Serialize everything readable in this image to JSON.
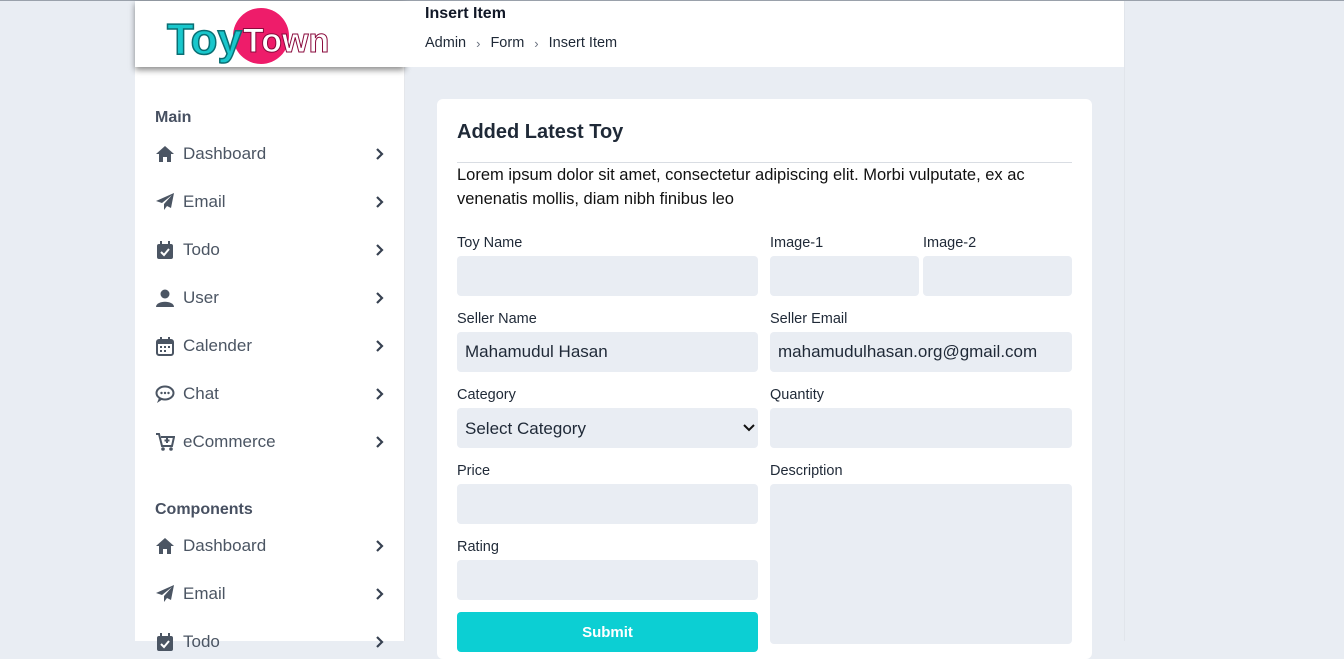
{
  "logo": {
    "text_toy": "Toy",
    "text_town": "Town"
  },
  "header": {
    "title": "Insert Item",
    "breadcrumb": [
      "Admin",
      "Form",
      "Insert Item"
    ]
  },
  "sidebar": {
    "main_heading": "Main",
    "main_items": [
      {
        "label": "Dashboard",
        "icon": "home-icon"
      },
      {
        "label": "Email",
        "icon": "paper-plane-icon"
      },
      {
        "label": "Todo",
        "icon": "calendar-check-icon"
      },
      {
        "label": "User",
        "icon": "user-icon"
      },
      {
        "label": "Calender",
        "icon": "calendar-icon"
      },
      {
        "label": "Chat",
        "icon": "chat-icon"
      },
      {
        "label": "eCommerce",
        "icon": "cart-plus-icon"
      }
    ],
    "components_heading": "Components",
    "components_items": [
      {
        "label": "Dashboard",
        "icon": "home-icon"
      },
      {
        "label": "Email",
        "icon": "paper-plane-icon"
      },
      {
        "label": "Todo",
        "icon": "calendar-check-icon"
      }
    ]
  },
  "card": {
    "title": "Added Latest Toy",
    "description": "Lorem ipsum dolor sit amet, consectetur adipiscing elit. Morbi vulputate, ex ac venenatis mollis, diam nibh finibus leo"
  },
  "form": {
    "toy_name": {
      "label": "Toy Name",
      "value": ""
    },
    "image1": {
      "label": "Image-1",
      "value": ""
    },
    "image2": {
      "label": "Image-2",
      "value": ""
    },
    "seller_name": {
      "label": "Seller Name",
      "value": "Mahamudul Hasan"
    },
    "seller_email": {
      "label": "Seller Email",
      "value": "mahamudulhasan.org@gmail.com"
    },
    "category": {
      "label": "Category",
      "selected": "Select Category"
    },
    "quantity": {
      "label": "Quantity",
      "value": ""
    },
    "price": {
      "label": "Price",
      "value": ""
    },
    "description": {
      "label": "Description",
      "value": ""
    },
    "rating": {
      "label": "Rating",
      "value": ""
    },
    "submit_label": "Submit"
  },
  "colors": {
    "accent": "#0ccfd3",
    "logo_pink": "#ee1c6a",
    "logo_teal": "#19c7cc",
    "field_bg": "#e9edf3",
    "page_bg": "#e9edf3"
  }
}
